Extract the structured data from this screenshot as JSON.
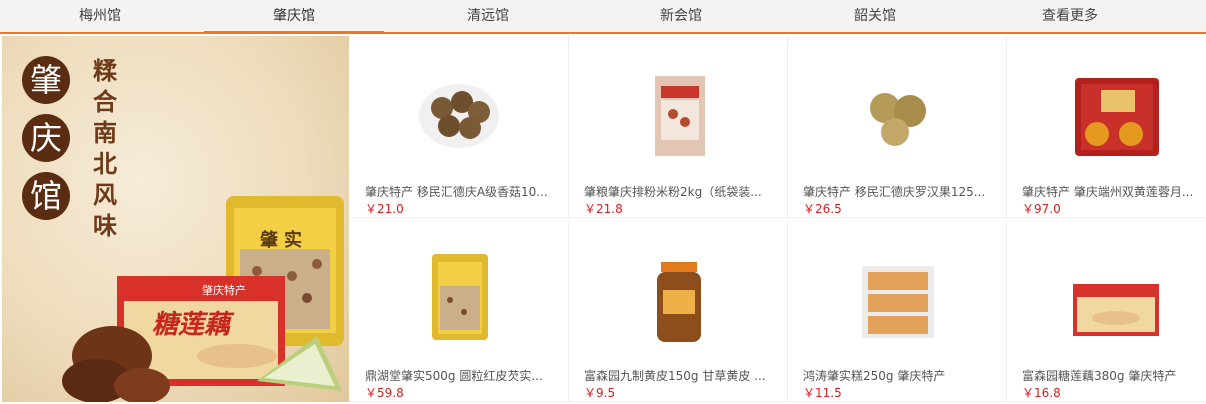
{
  "tabs": [
    {
      "label": "梅州馆"
    },
    {
      "label": "肇庆馆"
    },
    {
      "label": "清远馆"
    },
    {
      "label": "新会馆"
    },
    {
      "label": "韶关馆"
    },
    {
      "label": "查看更多"
    }
  ],
  "active_tab": "肇庆馆",
  "banner": {
    "circle_chars": [
      "肇",
      "庆",
      "馆"
    ],
    "slogan": "糅合南北风味",
    "rice_bag_text": "肇实",
    "lotus_box_text": "糖莲藕",
    "lotus_box_brand": "肇庆特产"
  },
  "products": [
    {
      "name": "肇庆特产 移民汇德庆A级香菇10...",
      "price": "￥21.0",
      "icon": "dried-mushroom-icon"
    },
    {
      "name": "肇粮肇庆排粉米粉2kg（纸袋装...",
      "price": "￥21.8",
      "icon": "rice-noodle-bag-icon"
    },
    {
      "name": "肇庆特产 移民汇德庆罗汉果125...",
      "price": "￥26.5",
      "icon": "luohan-fruit-icon"
    },
    {
      "name": "肇庆特产 肇庆端州双黄莲蓉月...",
      "price": "￥97.0",
      "icon": "mooncake-box-icon"
    },
    {
      "name": "鼎湖堂肇实500g 圆粒红皮芡实...",
      "price": "￥59.8",
      "icon": "euryale-seed-bag-icon"
    },
    {
      "name": "富森园九制黄皮150g 甘草黄皮 ...",
      "price": "￥9.5",
      "icon": "wampee-jar-icon"
    },
    {
      "name": "鸿涛肇实糕250g 肇庆特产",
      "price": "￥11.5",
      "icon": "euryale-cake-pack-icon"
    },
    {
      "name": "富森园糖莲藕380g 肇庆特产",
      "price": "￥16.8",
      "icon": "lotus-root-box-icon"
    }
  ],
  "colors": {
    "accent": "#e8762b",
    "price": "#d4201f",
    "circle": "#5a2c12"
  }
}
